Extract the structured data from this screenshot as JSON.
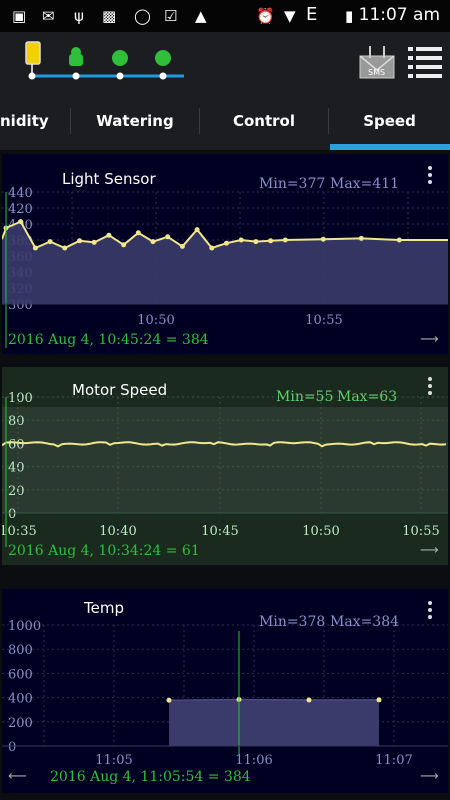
{
  "status": {
    "time": "11:07 am",
    "network": "E"
  },
  "tabs": [
    "nidity",
    "Watering",
    "Control",
    "Speed"
  ],
  "panels": {
    "light": {
      "title": "Light Sensor",
      "min_text": "Min=377",
      "max_text": "Max=411",
      "readout": "2016 Aug 4, 10:45:24 = 384",
      "y_ticks": [
        "440",
        "420",
        "400",
        "380",
        "360",
        "340",
        "320",
        "300"
      ],
      "x_ticks": [
        "10:50",
        "10:55"
      ]
    },
    "motor": {
      "title": "Motor Speed",
      "min_text": "Min=55",
      "max_text": "Max=63",
      "readout": "2016 Aug 4, 10:34:24 = 61",
      "y_ticks": [
        "100",
        "80",
        "60",
        "40",
        "20",
        "0"
      ],
      "x_ticks": [
        "10:35",
        "10:40",
        "10:45",
        "10:50",
        "10:55"
      ]
    },
    "temp": {
      "title": "Temp",
      "min_text": "Min=378",
      "max_text": "Max=384",
      "readout": "2016 Aug 4, 11:05:54 = 384",
      "y_ticks": [
        "1000",
        "800",
        "600",
        "400",
        "200",
        "0"
      ],
      "x_ticks": [
        "11:05",
        "11:06",
        "11:07"
      ]
    }
  },
  "colors": {
    "accent": "#2aa1de",
    "line": "#f2e68a",
    "readout": "#2fbf3a",
    "minmax_blue": "#8a8fc8",
    "minmax_green": "#5fd16a"
  },
  "chart_data": [
    {
      "type": "line",
      "title": "Light Sensor",
      "ylim": [
        300,
        440
      ],
      "x": [
        "10:46",
        "10:46:30",
        "10:47",
        "10:47:30",
        "10:48",
        "10:48:30",
        "10:49",
        "10:49:30",
        "10:50",
        "10:50:30",
        "10:51",
        "10:51:30",
        "10:52",
        "10:52:30",
        "10:53",
        "10:53:30",
        "10:54",
        "10:54:30",
        "10:55",
        "10:55:30",
        "10:56",
        "10:57",
        "10:58"
      ],
      "values": [
        395,
        403,
        370,
        378,
        370,
        379,
        377,
        386,
        374,
        389,
        378,
        384,
        372,
        393,
        370,
        376,
        380,
        378,
        379,
        380,
        381,
        382,
        380
      ]
    },
    {
      "type": "line",
      "title": "Motor Speed",
      "ylim": [
        0,
        100
      ],
      "x": [
        "10:34",
        "10:38",
        "10:42",
        "10:46",
        "10:50",
        "10:54",
        "10:56"
      ],
      "values": [
        61,
        59,
        60,
        58,
        60,
        59,
        60
      ]
    },
    {
      "type": "area",
      "title": "Temp",
      "ylim": [
        0,
        1000
      ],
      "x": [
        "11:05:20",
        "11:05:54",
        "11:06:30",
        "11:07:00"
      ],
      "values": [
        378,
        384,
        380,
        381
      ]
    }
  ]
}
